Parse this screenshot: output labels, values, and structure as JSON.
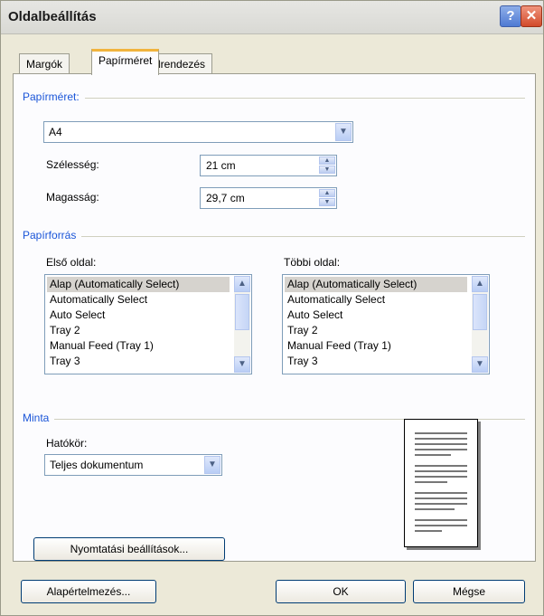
{
  "window": {
    "title": "Oldalbeállítás",
    "help": "?",
    "close": "✕"
  },
  "tabs": [
    "Margók",
    "Papírméret",
    "Elrendezés"
  ],
  "paper_size": {
    "group_title": "Papírméret:",
    "selected": "A4",
    "width_label": "Szélesség:",
    "width_value": "21 cm",
    "height_label": "Magasság:",
    "height_value": "29,7 cm"
  },
  "paper_source": {
    "group_title": "Papírforrás",
    "first_page_label": "Első oldal:",
    "other_pages_label": "Többi oldal:",
    "items": [
      "Alap (Automatically Select)",
      "Automatically Select",
      "Auto Select",
      "Tray 2",
      "Manual Feed (Tray 1)",
      "Tray 3"
    ]
  },
  "preview": {
    "group_title": "Minta",
    "apply_label": "Hatókör:",
    "apply_value": "Teljes dokumentum",
    "print_options": "Nyomtatási beállítások..."
  },
  "buttons": {
    "default": "Alapértelmezés...",
    "ok": "OK",
    "cancel": "Mégse"
  },
  "icons": {
    "dropdown": "▼",
    "up": "▲",
    "down": "▼"
  }
}
